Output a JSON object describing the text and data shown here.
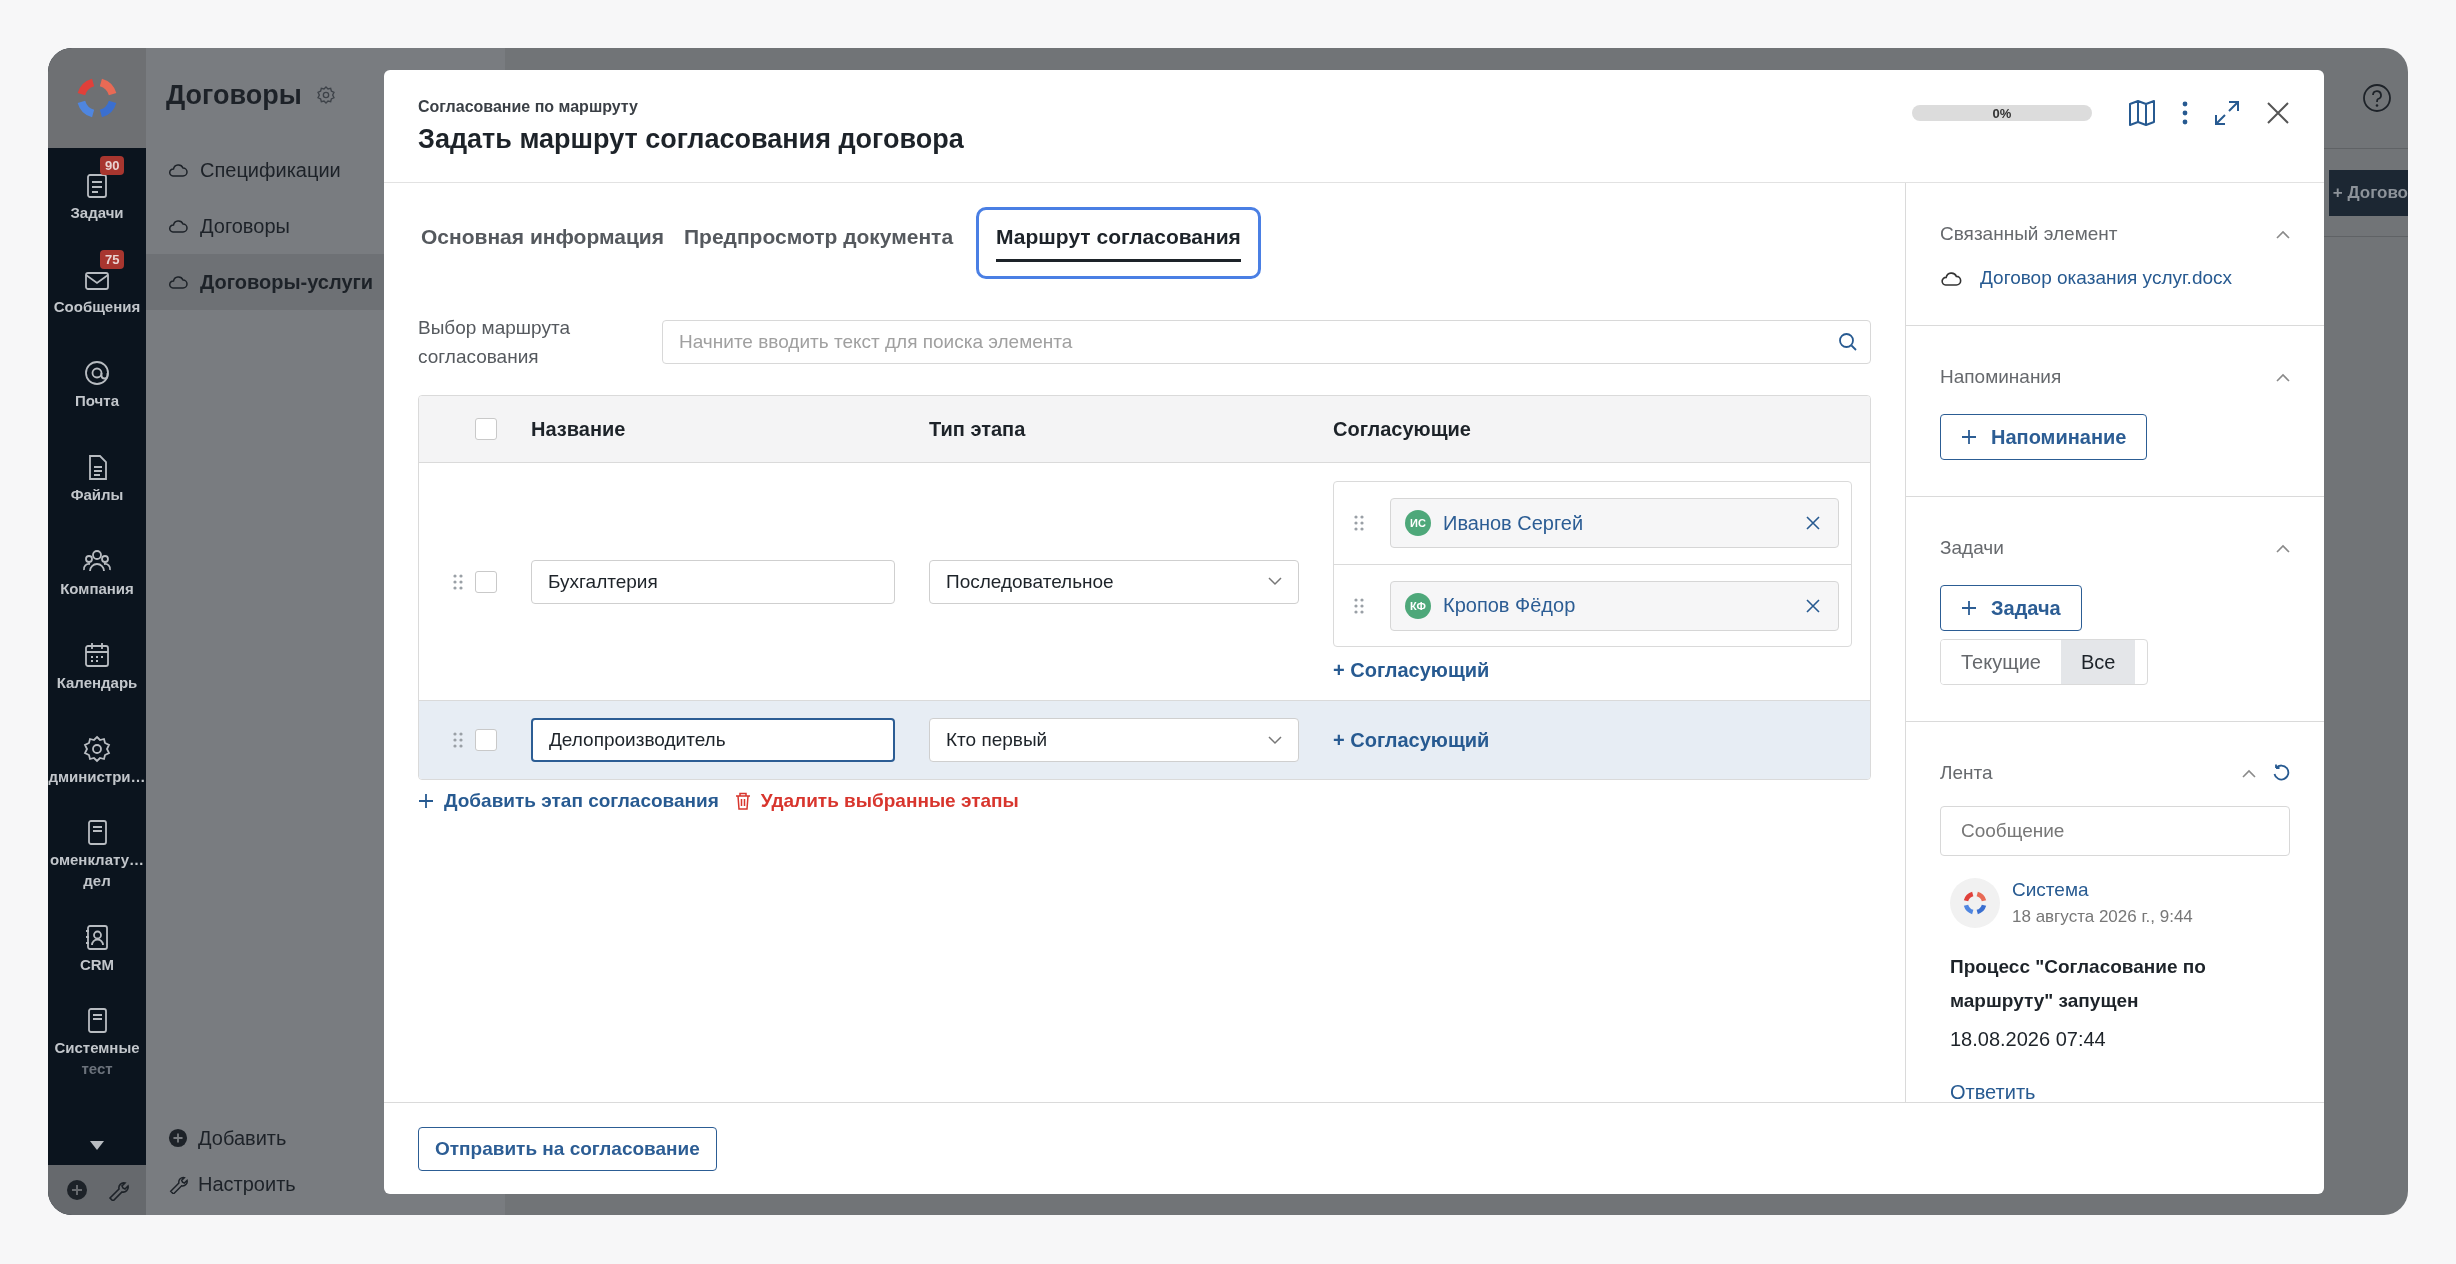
{
  "sidebar": {
    "items": [
      {
        "label": "Задачи",
        "badge": "90"
      },
      {
        "label": "Сообщения",
        "badge": "75"
      },
      {
        "label": "Почта"
      },
      {
        "label": "Файлы"
      },
      {
        "label": "Компания"
      },
      {
        "label": "Календарь"
      },
      {
        "label": "дминистри…"
      },
      {
        "label": "оменклату…",
        "label2": "дел"
      },
      {
        "label": "CRM"
      },
      {
        "label": "Системные",
        "label2": "тест"
      }
    ]
  },
  "nav": {
    "title": "Договоры",
    "items": [
      {
        "label": "Спецификации",
        "selected": false
      },
      {
        "label": "Договоры",
        "selected": false
      },
      {
        "label": "Договоры-услуги",
        "selected": true
      }
    ],
    "footer": [
      "Добавить",
      "Настроить"
    ]
  },
  "background": {
    "create_button": "+ Догово"
  },
  "dialog": {
    "subtitle": "Согласование по маршруту",
    "title": "Задать маршрут согласования договора",
    "progress": {
      "level": 0,
      "label": "0%"
    },
    "tabs": [
      {
        "label": "Основная информация",
        "selected": false
      },
      {
        "label": "Предпросмотр документа",
        "selected": false
      },
      {
        "label": "Маршрут согласования",
        "selected": true
      }
    ],
    "route_field": {
      "label": "Выбор маршрута согласования",
      "placeholder": "Начните вводить текст для поиска элемента"
    },
    "table": {
      "columns": [
        "Название",
        "Тип этапа",
        "Согласующие"
      ],
      "header_checked": false,
      "rows": [
        {
          "checked": false,
          "focused": false,
          "name": "Бухгалтерия",
          "stage_type": "Последовательное",
          "approvers": [
            {
              "initials": "ИС",
              "name": "Иванов Сергей"
            },
            {
              "initials": "КФ",
              "name": "Кропов Фёдор"
            }
          ],
          "add_approver": "+ Согласующий"
        },
        {
          "checked": false,
          "focused": true,
          "name": "Делопроизводитель",
          "stage_type": "Кто первый",
          "approvers": [],
          "add_approver": "+ Согласующий"
        }
      ]
    },
    "add_stage": "Добавить этап согласования",
    "delete_stages": "Удалить выбранные этапы",
    "submit": "Отправить на согласование"
  },
  "side_panel": {
    "related": {
      "title": "Связанный элемент",
      "link": "Договор оказания услуг.docx"
    },
    "reminders": {
      "title": "Напоминания",
      "button": "Напоминание"
    },
    "tasks": {
      "title": "Задачи",
      "button": "Задача",
      "filters": [
        {
          "label": "Текущие",
          "selected": false
        },
        {
          "label": "Все",
          "selected": true
        }
      ]
    },
    "feed": {
      "title": "Лента",
      "placeholder": "Сообщение",
      "entries": [
        {
          "author": "Система",
          "time": "18 августа 2026 г., 9:44",
          "text": "Процесс \"Согласование по маршруту\" запущен",
          "date": "18.08.2026 07:44",
          "reply": "Ответить"
        }
      ]
    }
  }
}
